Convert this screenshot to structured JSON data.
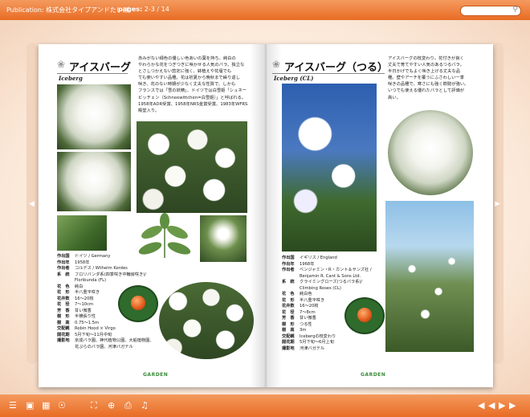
{
  "topbar": {
    "publication": "Publication: 株式会社タイプアンドたいぼ",
    "pages_label": "pages:",
    "pages_value": "2-3 / 14"
  },
  "left_page": {
    "title": "アイスバーグ",
    "subtitle": "Iceberg",
    "description": [
      "赤みがない緑色の優しい色あいの葉を持ち、純白の",
      "やわらかな花をつぎつぎに咲かせる人気のバラ。独立な",
      "とさしつかえない剪定に強く、鉢植えや花壇でも",
      "ても使いやすい品種。花は初夏から晩秋まで繰り返し",
      "咲き、花のない時期が少なく丈夫な性質で、しかも",
      "フランスでは「雪の妖精」、ドイツでは白雪姫「シュネー",
      "ビッチェン（Schneewittchen=白雪姫）」と呼ばれる。",
      "1958年ADR受賞、1958年NRS金賞受賞、1983年WFRS",
      "殿堂入り。"
    ],
    "data": [
      {
        "k": "作出国",
        "v": "ドイツ / Germany"
      },
      {
        "k": "作出年",
        "v": "1958年"
      },
      {
        "k": "作出者",
        "v": "コルデス / Wilhelm Kordes"
      },
      {
        "k": "系　統",
        "v": "フロリバンダ系(四季咲き中輪房咲き)/"
      },
      {
        "k": "",
        "v": "Floribunda (FL)"
      },
      {
        "k": "花　色",
        "v": "純白"
      },
      {
        "k": "花　形",
        "v": "半八重平咲き"
      },
      {
        "k": "花弁数",
        "v": "16〜20枚"
      },
      {
        "k": "花　径",
        "v": "7〜10cm"
      },
      {
        "k": "芳　香",
        "v": "甘い微香"
      },
      {
        "k": "樹　形",
        "v": "半横張り性"
      },
      {
        "k": "樹　高",
        "v": "0.75〜1.5m"
      },
      {
        "k": "交配親",
        "v": "Robin Hood × Virgo"
      },
      {
        "k": "開花期",
        "v": "5月下旬〜11月中旬"
      },
      {
        "k": "撮影地",
        "v": "京成バラ園、神代植物公園、大船植物園、"
      },
      {
        "k": "",
        "v": "花ぷらのバラ園、河津バガテル"
      }
    ],
    "logo": "GARDEN"
  },
  "right_page": {
    "title": "アイスバーグ（つる）",
    "subtitle": "Iceberg (CL)",
    "description": [
      "アイスバーグの枝変わり。花付きが良く",
      "丈夫で育てやすい人気のあるつるバラ。",
      "半日かげでもよく咲き上げる丈夫な品",
      "種。壁やアーチを覆うにふさわしい一季",
      "咲きの品種で、寒さにも強く樹勢が強い。",
      "いつでも使える優れたバラとして評価が",
      "高い。"
    ],
    "data": [
      {
        "k": "作出国",
        "v": "イギリス / England"
      },
      {
        "k": "作出年",
        "v": "1968年"
      },
      {
        "k": "作出者",
        "v": "ベンジャミン・R・カント＆サンズ社 /"
      },
      {
        "k": "",
        "v": "Benjamin R. Cant & Sons Ltd."
      },
      {
        "k": "系　統",
        "v": "クライミングローズ(つるバラ系)/"
      },
      {
        "k": "",
        "v": "Climbing Roses (CL)"
      },
      {
        "k": "花　色",
        "v": "純白色"
      },
      {
        "k": "花　形",
        "v": "半八重平咲き"
      },
      {
        "k": "花弁数",
        "v": "16〜20枚"
      },
      {
        "k": "花　径",
        "v": "7〜8cm"
      },
      {
        "k": "芳　香",
        "v": "甘い微香"
      },
      {
        "k": "樹　形",
        "v": "つる性"
      },
      {
        "k": "樹　高",
        "v": "3m"
      },
      {
        "k": "交配親",
        "v": "Icebergの枝変わり"
      },
      {
        "k": "開花期",
        "v": "5月下旬〜6月上旬"
      },
      {
        "k": "撮影地",
        "v": "河津バガテル"
      }
    ],
    "logo": "GARDEN"
  },
  "icons": {
    "search": "magnifier-icon",
    "prev": "chevron-left-icon",
    "next": "chevron-right-icon"
  },
  "colors": {
    "toolbar": "#e86c24",
    "stage": "#fdf3ea"
  }
}
